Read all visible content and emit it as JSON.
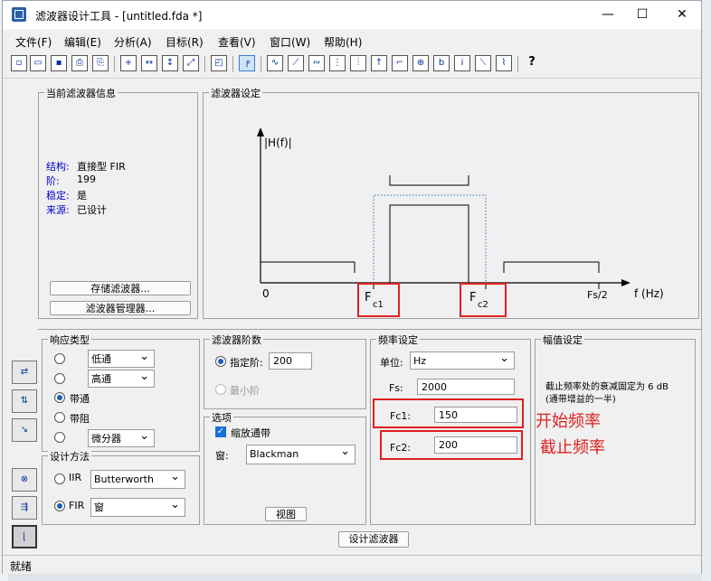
{
  "window": {
    "title": "滤波器设计工具 - [untitled.fda *]",
    "minimize": "—",
    "maximize": "☐",
    "close": "✕"
  },
  "menu": [
    "文件(F)",
    "编辑(E)",
    "分析(A)",
    "目标(R)",
    "查看(V)",
    "窗口(W)",
    "帮助(H)"
  ],
  "toolbar_icons": [
    "new-file",
    "open-folder",
    "save",
    "print",
    "print-preview",
    "zoom-in",
    "zoom-x",
    "zoom-fit",
    "full-view",
    "new-figure",
    "filter-spec",
    "magnitude",
    "phase",
    "mag-phase",
    "group-delay",
    "phase-delay",
    "impulse",
    "step",
    "pole-zero",
    "coefficients",
    "info",
    "cost",
    "round-off",
    "whats-this"
  ],
  "info_panel": {
    "title": "当前滤波器信息",
    "rows": [
      {
        "label": "结构:",
        "value": "直接型 FIR"
      },
      {
        "label": "阶:",
        "value": "199"
      },
      {
        "label": "稳定:",
        "value": "是"
      },
      {
        "label": "来源:",
        "value": "已设计"
      }
    ],
    "store_button": "存储滤波器...",
    "manager_button": "滤波器管理器..."
  },
  "spec_panel": {
    "title": "滤波器设定",
    "y_label": "|H(f)|",
    "x_label": "f (Hz)",
    "zero": "0",
    "fs2": "Fs/2",
    "fc1": "F",
    "fc1_sub": "c1",
    "fc2": "F",
    "fc2_sub": "c2"
  },
  "response_panel": {
    "title": "响应类型",
    "options": [
      {
        "label": "低通",
        "kind": "dropdown"
      },
      {
        "label": "高通",
        "kind": "dropdown"
      },
      {
        "label": "带通",
        "kind": "plain"
      },
      {
        "label": "带阻",
        "kind": "plain"
      },
      {
        "label": "微分器",
        "kind": "dropdown"
      }
    ],
    "selected": "带通"
  },
  "design_panel": {
    "title": "设计方法",
    "iir_label": "IIR",
    "iir_value": "Butterworth",
    "fir_label": "FIR",
    "fir_value": "窗",
    "selected": "FIR"
  },
  "order_panel": {
    "title": "滤波器阶数",
    "specify_label": "指定阶:",
    "specify_value": "200",
    "min_label": "最小阶"
  },
  "options_panel": {
    "title": "选项",
    "scale_label": "缩放通带",
    "window_label": "窗:",
    "window_value": "Blackman",
    "view_button": "视图"
  },
  "freq_panel": {
    "title": "频率设定",
    "unit_label": "单位:",
    "unit_value": "Hz",
    "fs_label": "Fs:",
    "fs_value": "2000",
    "fc1_label": "Fc1:",
    "fc1_value": "150",
    "fc2_label": "Fc2:",
    "fc2_value": "200"
  },
  "annotations": {
    "start_freq": "开始频率",
    "stop_freq": "截止频率"
  },
  "mag_panel": {
    "title": "幅值设定",
    "note": "截止频率处的衰减固定为 6 dB\n(通带增益的一半)"
  },
  "design_button": "设计滤波器",
  "status": "就绪"
}
